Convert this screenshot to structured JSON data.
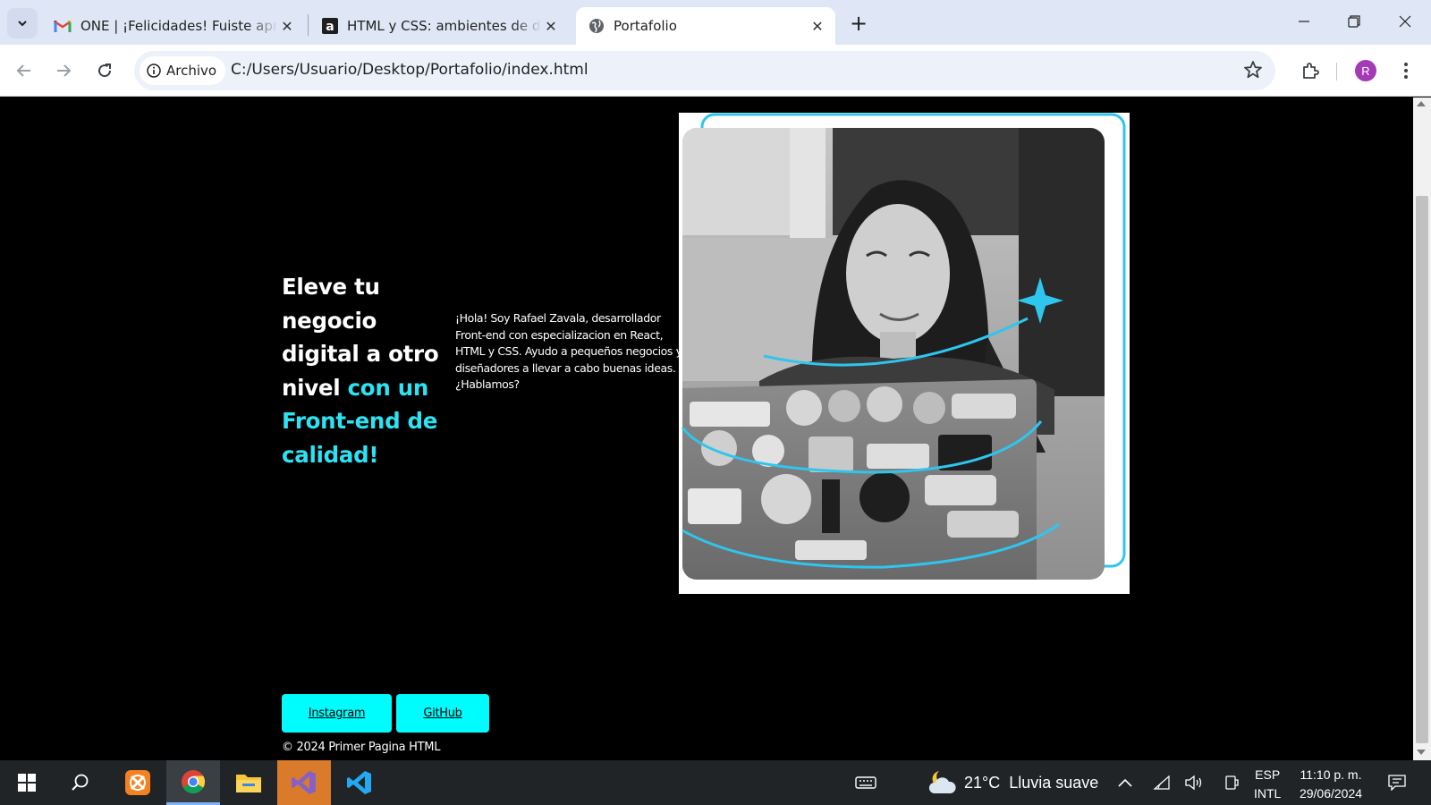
{
  "browser": {
    "tabs": [
      {
        "title": "ONE | ¡Felicidades! Fuiste aprobado",
        "icon": "gmail-icon",
        "active": false
      },
      {
        "title": "HTML y CSS: ambientes de desarrollo",
        "icon": "alura-icon",
        "active": false
      },
      {
        "title": "Portafolio",
        "icon": "globe-icon",
        "active": true
      }
    ],
    "site_chip_label": "Archivo",
    "url": "C:/Users/Usuario/Desktop/Portafolio/index.html",
    "profile_initial": "R",
    "accent_color": "#a43ab6"
  },
  "page": {
    "headline_white": "Eleve tu negocio digital a otro nivel ",
    "headline_accent": "con un Front-end de calidad!",
    "intro": "¡Hola! Soy Rafael Zavala, desarrollador Front-end con especializacion en React, HTML y CSS. Ayudo a pequeños negocios y diseñadores a llevar a cabo buenas ideas. ¿Hablamos?",
    "buttons": {
      "instagram": "Instagram",
      "github": "GitHub"
    },
    "footer": "© 2024 Primer Pagina HTML",
    "accent_color": "#2de2f2",
    "button_color": "#00fdfd"
  },
  "taskbar": {
    "weather": {
      "temp": "21°C",
      "condition": "Lluvia suave"
    },
    "language": {
      "line1": "ESP",
      "line2": "INTL"
    },
    "clock": {
      "time": "11:10 p. m.",
      "date": "29/06/2024"
    }
  }
}
